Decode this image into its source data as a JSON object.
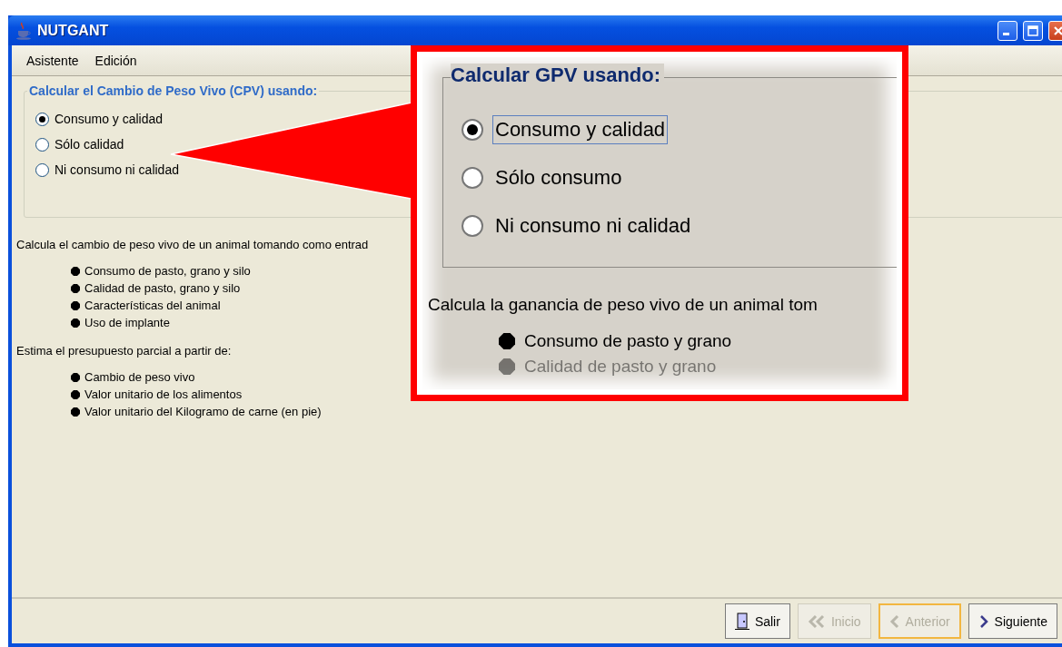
{
  "window": {
    "title": "NUTGANT"
  },
  "menu": [
    "Asistente",
    "Edición"
  ],
  "group": {
    "title": "Calcular el Cambio de Peso Vivo (CPV) usando:",
    "options": [
      {
        "label": "Consumo y calidad",
        "selected": true
      },
      {
        "label": "Sólo calidad",
        "selected": false
      },
      {
        "label": "Ni consumo ni calidad",
        "selected": false
      }
    ]
  },
  "description": [
    {
      "text": "Calcula el cambio de peso vivo de un animal tomando como entrad",
      "bullets": [
        "Consumo de pasto, grano y silo",
        "Calidad de pasto, grano y silo",
        "Características del animal",
        "Uso de implante"
      ]
    },
    {
      "text": "Estima el presupuesto parcial a partir de:",
      "bullets": [
        "Cambio de peso vivo",
        "Valor unitario de los alimentos",
        "Valor unitario del Kilogramo de carne (en pie)"
      ]
    }
  ],
  "buttons": [
    {
      "kind": "exit",
      "label": "Salir",
      "disabled": false,
      "focused": false
    },
    {
      "kind": "first",
      "label": "Inicio",
      "disabled": true,
      "focused": false
    },
    {
      "kind": "back",
      "label": "Anterior",
      "disabled": true,
      "focused": true
    },
    {
      "kind": "next",
      "label": "Siguiente",
      "disabled": false,
      "focused": false
    }
  ],
  "callout": {
    "title": "Calcular GPV usando:",
    "options": [
      {
        "label": "Consumo y calidad",
        "selected": true,
        "focused": true
      },
      {
        "label": "Sólo consumo",
        "selected": false,
        "focused": false
      },
      {
        "label": "Ni consumo ni calidad",
        "selected": false,
        "focused": false
      }
    ],
    "text": "Calcula la ganancia de peso vivo de un animal tom",
    "bullets": [
      {
        "label": "Consumo de pasto y grano",
        "faded": false
      },
      {
        "label": "Calidad de pasto y grano",
        "faded": true
      }
    ]
  }
}
